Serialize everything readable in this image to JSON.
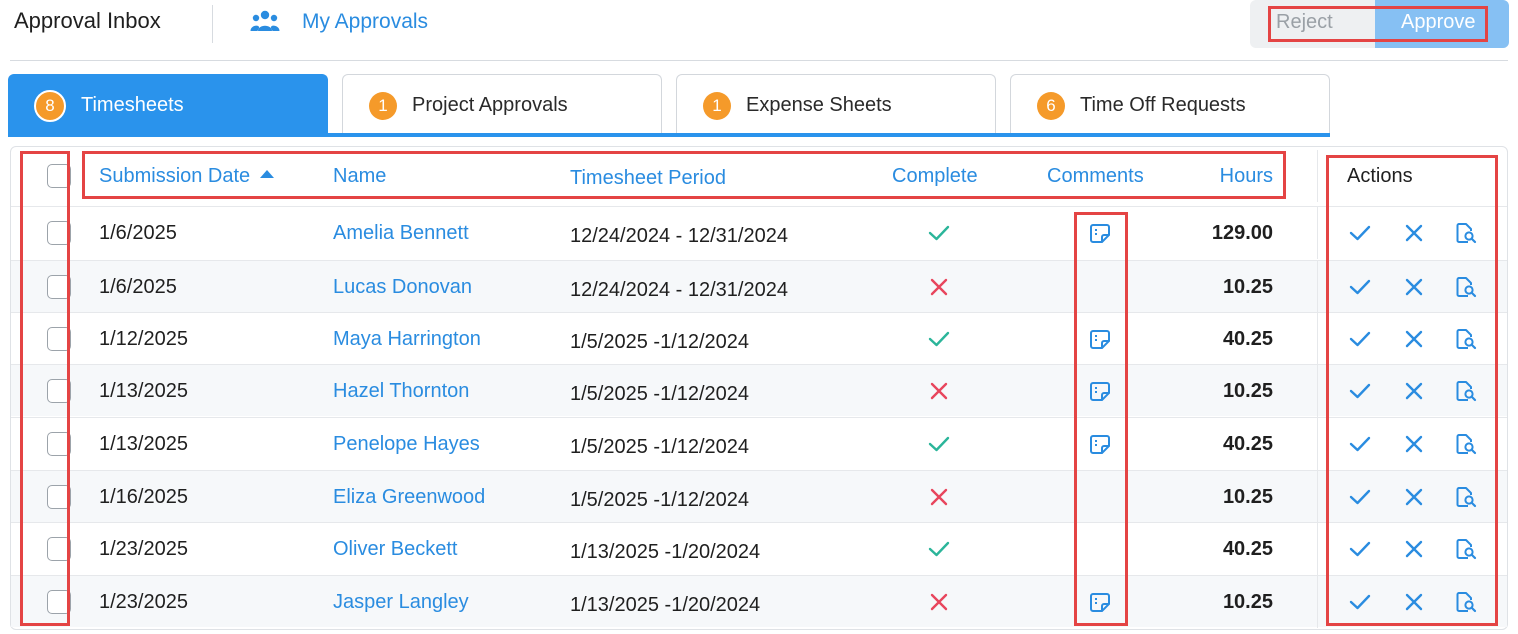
{
  "header": {
    "title": "Approval Inbox",
    "my_approvals": "My Approvals",
    "reject_label": "Reject",
    "approve_label": "Approve"
  },
  "tabs": [
    {
      "count": "8",
      "label": "Timesheets",
      "active": true
    },
    {
      "count": "1",
      "label": "Project Approvals",
      "active": false
    },
    {
      "count": "1",
      "label": "Expense Sheets",
      "active": false
    },
    {
      "count": "6",
      "label": "Time Off Requests",
      "active": false
    }
  ],
  "table": {
    "columns": {
      "submission_date": "Submission Date",
      "name": "Name",
      "period": "Timesheet Period",
      "complete": "Complete",
      "comments": "Comments",
      "hours": "Hours",
      "actions": "Actions"
    },
    "rows": [
      {
        "date": "1/6/2025",
        "name": "Amelia Bennett",
        "period": "12/24/2024 - 12/31/2024",
        "complete": true,
        "has_comment": true,
        "hours": "129.00"
      },
      {
        "date": "1/6/2025",
        "name": "Lucas Donovan",
        "period": "12/24/2024 - 12/31/2024",
        "complete": false,
        "has_comment": false,
        "hours": "10.25"
      },
      {
        "date": "1/12/2025",
        "name": "Maya Harrington",
        "period": "1/5/2025 -1/12/2024",
        "complete": true,
        "has_comment": true,
        "hours": "40.25"
      },
      {
        "date": "1/13/2025",
        "name": "Hazel Thornton",
        "period": "1/5/2025 -1/12/2024",
        "complete": false,
        "has_comment": true,
        "hours": "10.25"
      },
      {
        "date": "1/13/2025",
        "name": "Penelope Hayes",
        "period": "1/5/2025 -1/12/2024",
        "complete": true,
        "has_comment": true,
        "hours": "40.25"
      },
      {
        "date": "1/16/2025",
        "name": "Eliza Greenwood",
        "period": "1/5/2025 -1/12/2024",
        "complete": false,
        "has_comment": false,
        "hours": "10.25"
      },
      {
        "date": "1/23/2025",
        "name": "Oliver Beckett",
        "period": "1/13/2025 -1/20/2024",
        "complete": true,
        "has_comment": false,
        "hours": "40.25"
      },
      {
        "date": "1/23/2025",
        "name": "Jasper Langley",
        "period": "1/13/2025 -1/20/2024",
        "complete": false,
        "has_comment": true,
        "hours": "10.25"
      }
    ]
  },
  "colors": {
    "accent": "#2a93ec",
    "link": "#2a8ce0",
    "badge": "#f59a2a",
    "check": "#2bb59a",
    "cross": "#e8455c",
    "highlight": "#e44444"
  }
}
